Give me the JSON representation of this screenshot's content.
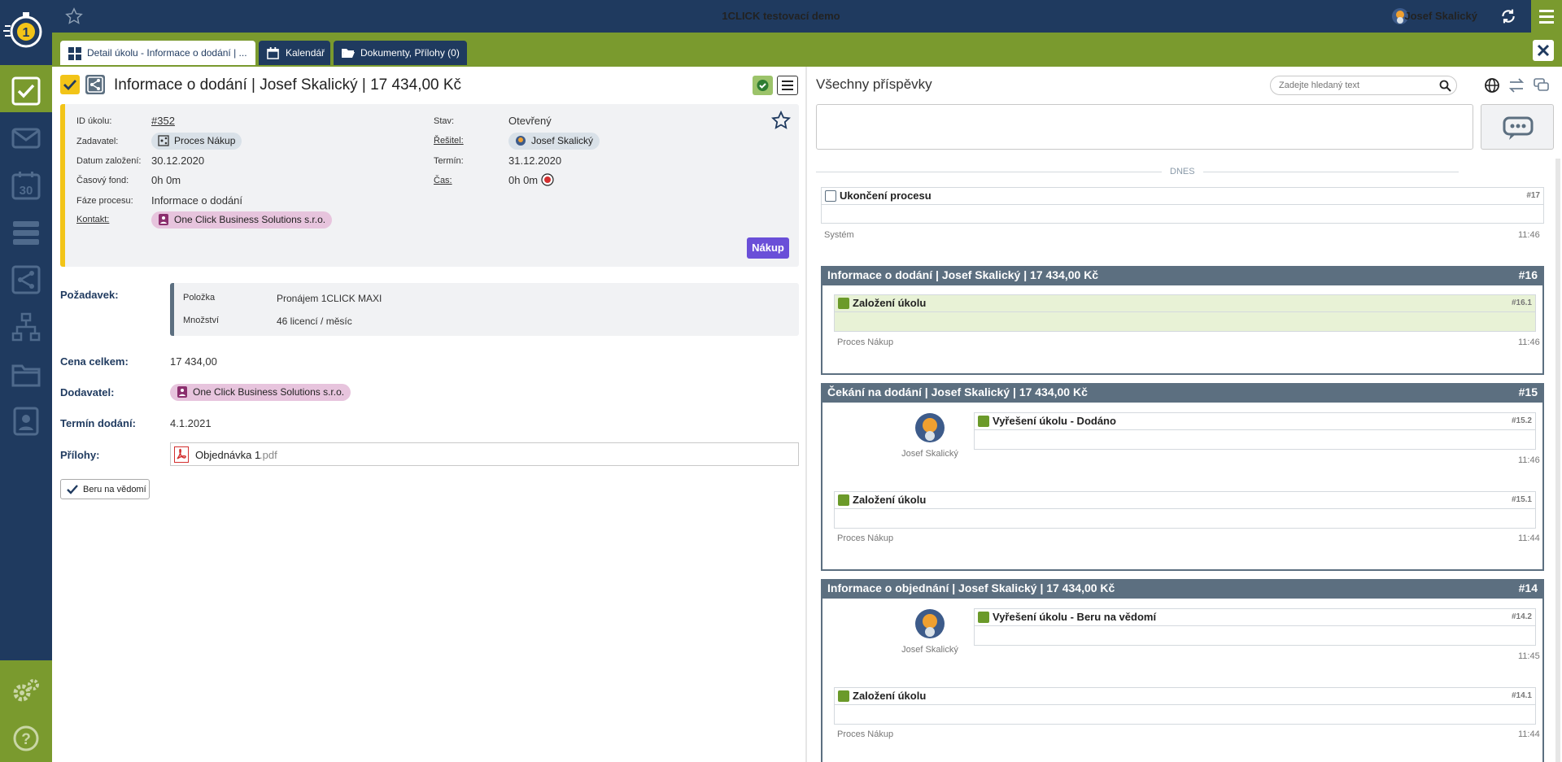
{
  "app": {
    "title": "1CLICK testovací demo",
    "user": "Josef Skalický"
  },
  "tabs": [
    {
      "label": "Detail úkolu - Informace o dodání | ..."
    },
    {
      "label": "Kalendář"
    },
    {
      "label": "Dokumenty, Přílohy (0)"
    }
  ],
  "task": {
    "title": "Informace o dodání | Josef Skalický | 17 434,00 Kč",
    "fields": {
      "id_label": "ID úkolu:",
      "id_value": "#352",
      "zadavatel_label": "Zadavatel:",
      "zadavatel_value": "Proces Nákup",
      "datum_label": "Datum založení:",
      "datum_value": "30.12.2020",
      "fond_label": "Časový fond:",
      "fond_value": "0h 0m",
      "faze_label": "Fáze procesu:",
      "faze_value": "Informace o dodání",
      "kontakt_label": "Kontakt:",
      "kontakt_value": "One Click Business Solutions s.r.o.",
      "stav_label": "Stav:",
      "stav_value": "Otevřený",
      "resitel_label": "Řešitel:",
      "resitel_value": "Josef Skalický",
      "termin_label": "Termín:",
      "termin_value": "31.12.2020",
      "cas_label": "Čas:",
      "cas_value": "0h 0m"
    },
    "category_badge": "Nákup"
  },
  "details": {
    "pozadavek_label": "Požadavek:",
    "polozka_label": "Položka",
    "polozka_value": "Pronájem 1CLICK MAXI",
    "mnozstvi_label": "Množství",
    "mnozstvi_value": "46 licencí / měsíc",
    "cena_label": "Cena celkem:",
    "cena_value": "17 434,00",
    "dodavatel_label": "Dodavatel:",
    "dodavatel_value": "One Click Business Solutions s.r.o.",
    "termin_dodani_label": "Termín dodání:",
    "termin_dodani_value": "4.1.2021",
    "prilohy_label": "Přílohy:",
    "priloha_name": "Objednávka 1",
    "priloha_ext": ".pdf",
    "ack_button": "Beru na vědomí"
  },
  "feed": {
    "title": "Všechny příspěvky",
    "search_placeholder": "Zadejte hledaný text",
    "separator": "DNES",
    "entries": [
      {
        "title": "Ukončení procesu",
        "num": "#17",
        "author": "Systém",
        "time": "11:46"
      }
    ],
    "groups": [
      {
        "title": "Informace o dodání | Josef Skalický | 17 434,00 Kč",
        "num": "#16",
        "items": [
          {
            "title": "Založení úkolu",
            "num": "#16.1",
            "author": "Proces Nákup",
            "time": "11:46"
          }
        ]
      },
      {
        "title": "Čekání na dodání | Josef Skalický | 17 434,00 Kč",
        "num": "#15",
        "items": [
          {
            "title": "Vyřešení úkolu - Dodáno",
            "num": "#15.2",
            "author": "Josef Skalický",
            "time": "11:46"
          },
          {
            "title": "Založení úkolu",
            "num": "#15.1",
            "author": "Proces Nákup",
            "time": "11:44"
          }
        ]
      },
      {
        "title": "Informace o objednání | Josef Skalický | 17 434,00 Kč",
        "num": "#14",
        "items": [
          {
            "title": "Vyřešení úkolu - Beru na vědomí",
            "num": "#14.2",
            "author": "Josef Skalický",
            "time": "11:45"
          },
          {
            "title": "Založení úkolu",
            "num": "#14.1",
            "author": "Proces Nákup",
            "time": "11:44"
          }
        ]
      }
    ]
  },
  "colors": {
    "navy": "#1f3a5f",
    "green": "#7a9a2e",
    "purple": "#6a4fd8",
    "chip_blue": "#d9e1e8",
    "chip_pink": "#e7c4dd",
    "yellow": "#f2c418"
  }
}
